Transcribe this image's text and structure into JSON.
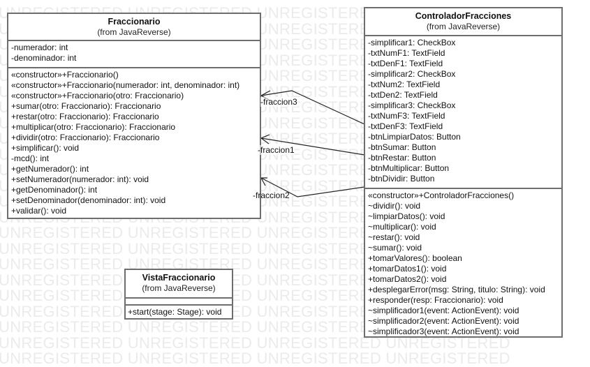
{
  "watermark": "UNREGISTERED UNREGISTERED UNREGISTERED UNREGISTERED",
  "classes": {
    "fraccionario": {
      "name": "Fraccionario",
      "from": "(from JavaReverse)",
      "attributes": [
        "-numerador: int",
        "-denominador: int"
      ],
      "methods": [
        "«constructor»+Fraccionario()",
        "«constructor»+Fraccionario(numerador: int, denominador: int)",
        "«constructor»+Fraccionario(otro: Fraccionario)",
        "+sumar(otro: Fraccionario): Fraccionario",
        "+restar(otro: Fraccionario): Fraccionario",
        "+multiplicar(otro: Fraccionario): Fraccionario",
        "+dividir(otro: Fraccionario): Fraccionario",
        "+simplificar(): void",
        "-mcd(): int",
        "+getNumerador(): int",
        "+setNumerador(numerador: int): void",
        "+getDenominador(): int",
        "+setDenominador(denominador: int): void",
        "+validar(): void"
      ]
    },
    "controlador": {
      "name": "ControladorFracciones",
      "from": "(from JavaReverse)",
      "attributes": [
        "-simplificar1: CheckBox",
        "-txtNumF1: TextField",
        "-txtDenF1: TextField",
        "-simplificar2: CheckBox",
        "-txtNum2: TextField",
        "-txtDen2: TextField",
        "-simplificar3: CheckBox",
        "-txtNumF3: TextField",
        "-txtDenF3: TextField",
        "-btnLimpiarDatos: Button",
        "-btnSumar: Button",
        "-btnRestar: Button",
        "-btnMultiplicar: Button",
        "-btnDividir: Button"
      ],
      "methods": [
        "«constructor»+ControladorFracciones()",
        "~dividir(): void",
        "~limpiarDatos(): void",
        "~multiplicar(): void",
        "~restar(): void",
        "~sumar(): void",
        "+tomarValores(): boolean",
        "+tomarDatos1(): void",
        "+tomarDatos2(): void",
        "+desplegarError(msg: String, titulo: String): void",
        "+responder(resp: Fraccionario): void",
        "~simplificador1(event: ActionEvent): void",
        "~simplificador2(event: ActionEvent): void",
        "~simplificador3(event: ActionEvent): void"
      ]
    },
    "vista": {
      "name": "VistaFraccionario",
      "from": "(from JavaReverse)",
      "attributes": [],
      "methods": [
        "+start(stage: Stage): void"
      ]
    }
  },
  "associations": [
    {
      "label": "-fraccion3",
      "from": "ControladorFracciones",
      "to": "Fraccionario"
    },
    {
      "label": "-fraccion1",
      "from": "ControladorFracciones",
      "to": "Fraccionario"
    },
    {
      "label": "-fraccion2",
      "from": "ControladorFracciones",
      "to": "Fraccionario"
    }
  ]
}
